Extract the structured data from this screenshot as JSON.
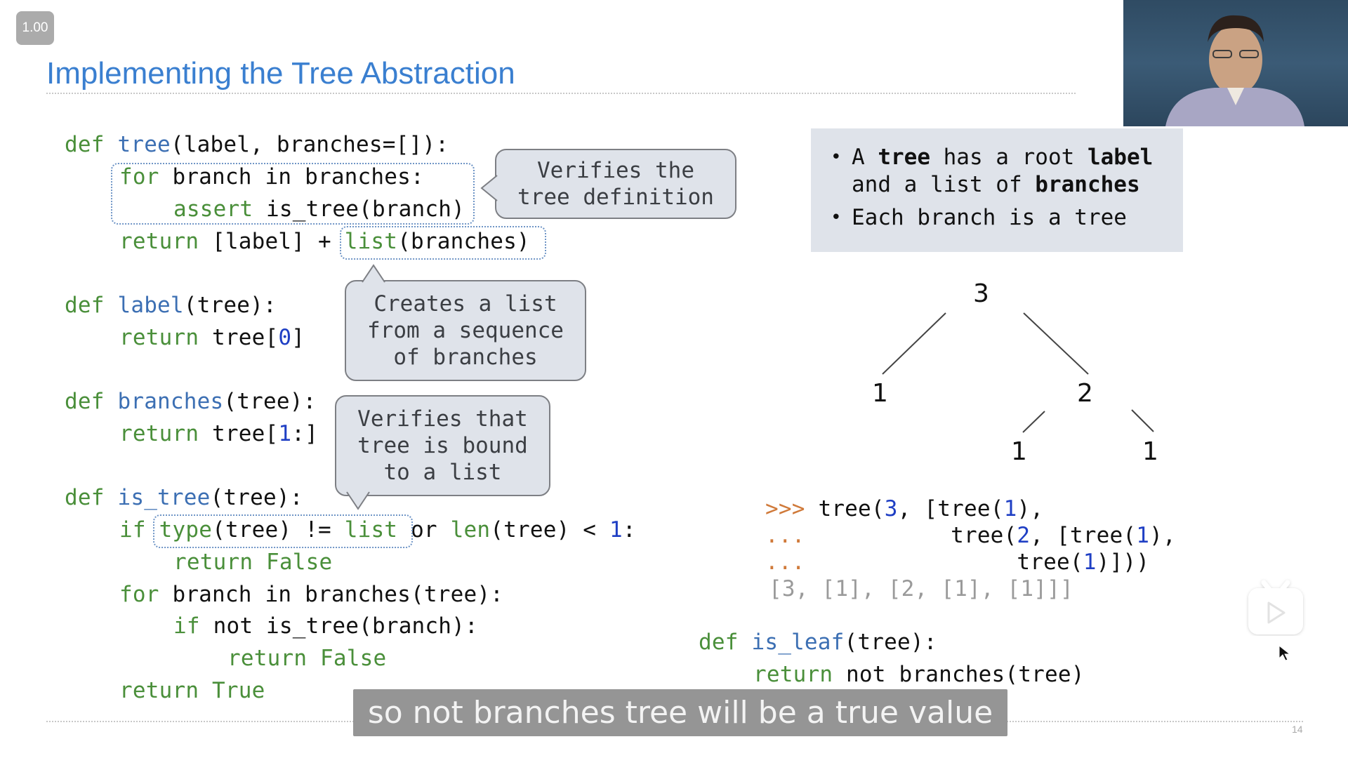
{
  "player": {
    "speed": "1.00",
    "subtitle": "so not branches tree will be a true value",
    "page_number": "14",
    "tv_icon": "tv-play-icon",
    "cursor_icon": "mouse-pointer-icon"
  },
  "slide": {
    "title": "Implementing the Tree Abstraction",
    "code_left": {
      "tree_def": {
        "kw_def": "def",
        "name": "tree",
        "sig": "(label, branches=[]):",
        "for_kw": "for",
        "for_rest": " branch in branches:",
        "assert_kw": "assert",
        "assert_rest": " is_tree(branch)",
        "return_kw": "return",
        "return_mid": " [label] + ",
        "list_fn": "list",
        "list_rest": "(branches)"
      },
      "label_def": {
        "kw_def": "def",
        "name": "label",
        "sig": "(tree):",
        "return_kw": "return",
        "return_pre": " tree[",
        "index": "0",
        "return_post": "]"
      },
      "branches_def": {
        "kw_def": "def",
        "name": "branches",
        "sig": "(tree):",
        "return_kw": "return",
        "return_pre": " tree[",
        "index": "1",
        "return_post": ":]"
      },
      "is_tree_def": {
        "kw_def": "def",
        "name": "is_tree",
        "sig": "(tree):",
        "if_kw": "if",
        "type_fn": "type",
        "type_rest": "(tree) != ",
        "list_kw": "list",
        "or_text": "or ",
        "len_fn": "len",
        "len_rest": "(tree) < ",
        "one": "1",
        "colon": ":",
        "return_false_1": "return False",
        "for_kw": "for",
        "for_rest": " branch in branches(tree):",
        "if2_kw": "if",
        "if2_rest": " not is_tree(branch):",
        "return_false_2": "return False",
        "return_true": "return True"
      }
    },
    "bubbles": {
      "verifies_definition": "Verifies the\ntree definition",
      "creates_list": "Creates a list\nfrom a sequence\nof branches",
      "verifies_list": "Verifies that\ntree is bound\nto a list"
    },
    "info_box": {
      "bullet1_a": "A ",
      "bullet1_b": "tree",
      "bullet1_c": " has a root ",
      "bullet1_d": "label",
      "bullet1_e": "and a list of ",
      "bullet1_f": "branches",
      "bullet2": "Each branch is a tree"
    },
    "tree_diagram": {
      "root": "3",
      "left_child": "1",
      "right_child": "2",
      "right_left_child": "1",
      "right_right_child": "1"
    },
    "repl": {
      "prompt": ">>>",
      "cont1": "...",
      "cont2": "...",
      "line1_pre": " tree(",
      "line1_n1": "3",
      "line1_mid": ", [tree(",
      "line1_n2": "1",
      "line1_post": "),",
      "line2_pre": "           tree(",
      "line2_n1": "2",
      "line2_mid": ", [tree(",
      "line2_n2": "1",
      "line2_post": "),",
      "line3_pre": "                tree(",
      "line3_n1": "1",
      "line3_post": ")]))",
      "output": "[3, [1], [2, [1], [1]]]"
    },
    "is_leaf_def": {
      "kw_def": "def",
      "name": "is_leaf",
      "sig": "(tree):",
      "return_kw": "return",
      "return_rest": " not branches(tree)"
    }
  }
}
